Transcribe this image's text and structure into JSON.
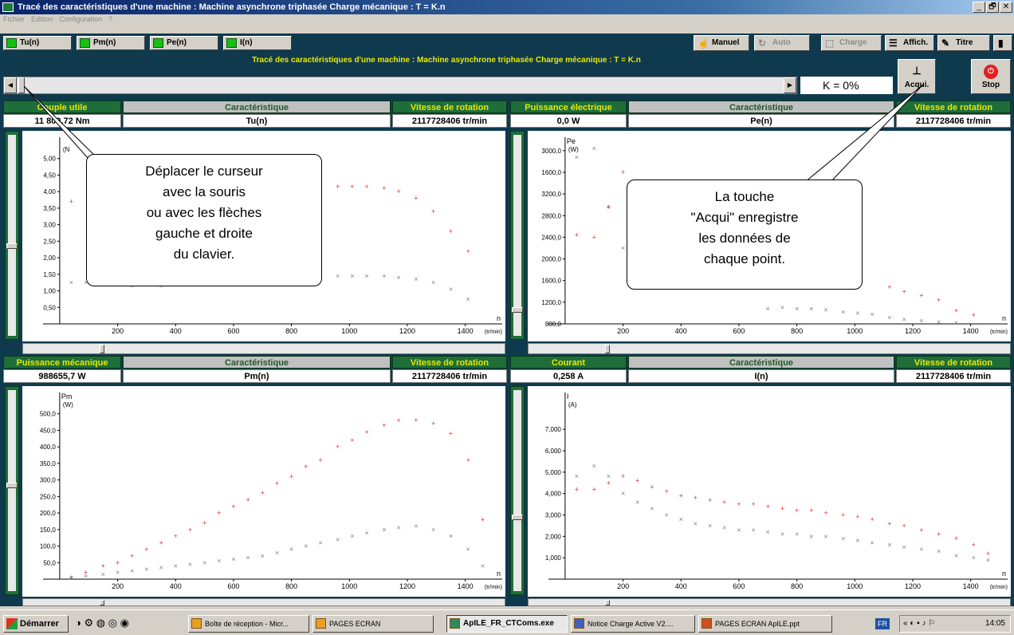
{
  "window": {
    "title": "Tracé des caractéristiques d'une machine : Machine asynchrone triphasée Charge mécanique : T = K.n",
    "controls": [
      "_",
      "🗗",
      "✕"
    ]
  },
  "menu": [
    "Fichier",
    "Edition",
    "Configuration",
    "?"
  ],
  "toolbar": {
    "curves": [
      "Tu(n)",
      "Pm(n)",
      "Pe(n)",
      "I(n)"
    ],
    "manuel": "Manuel",
    "auto": "Auto",
    "charge": "Charge",
    "affich": "Affich.",
    "titre": "Titre"
  },
  "banner": "Tracé des caractéristiques d'une machine : Machine asynchrone triphasée Charge mécanique : T = K.n",
  "k_value": "K = 0%",
  "acqui_label": "Acqui.",
  "stop_label": "Stop",
  "panels": [
    {
      "name": "Couple utile",
      "col": "Caractéristique",
      "speed_label": "Vitesse de rotation",
      "value": "11 800,72 Nm",
      "func": "Tu(n)",
      "speed": "2117728406 tr/min",
      "unit": "(N",
      "ylabel": ""
    },
    {
      "name": "Puissance électrique",
      "col": "Caractéristique",
      "speed_label": "Vitesse de rotation",
      "value": "0,0 W",
      "func": "Pe(n)",
      "speed": "2117728406 tr/min",
      "unit": "(W)",
      "ylabel": "Pe"
    },
    {
      "name": "Puissance mécanique",
      "col": "Caractéristique",
      "speed_label": "Vitesse de rotation",
      "value": "988655,7 W",
      "func": "Pm(n)",
      "speed": "2117728406 tr/min",
      "unit": "(W)",
      "ylabel": "Pm"
    },
    {
      "name": "Courant",
      "col": "Caractéristique",
      "speed_label": "Vitesse de rotation",
      "value": "0,258 A",
      "func": "I(n)",
      "speed": "2117728406 tr/min",
      "unit": "(A)",
      "ylabel": "I"
    }
  ],
  "chart_data": [
    {
      "type": "scatter",
      "xlabel": "n",
      "xunit": "(tr/min)",
      "xticks": [
        200,
        400,
        600,
        800,
        1000,
        1200,
        1400
      ],
      "ylim": [
        0,
        5.5
      ],
      "yticks": [
        "5,00",
        "4,50",
        "4,00",
        "3,50",
        "3,00",
        "2,50",
        "2,00",
        "1,50",
        "1,00",
        "0,50"
      ],
      "ytick_values": [
        5,
        4.5,
        4,
        3.5,
        3,
        2.5,
        2,
        1.5,
        1,
        0.5
      ],
      "series": [
        {
          "marker": "+",
          "color": "#e03030",
          "x": [
            40,
            100,
            960,
            1010,
            1060,
            1120,
            1170,
            1230,
            1290,
            1350,
            1410
          ],
          "values": [
            3.7,
            3.6,
            4.15,
            4.15,
            4.15,
            4.1,
            4.0,
            3.8,
            3.4,
            2.8,
            2.2
          ]
        },
        {
          "marker": "x",
          "color": "#808080",
          "x": [
            40,
            90,
            150,
            200,
            250,
            300,
            350,
            400,
            450,
            500,
            550,
            600,
            650,
            700,
            750,
            800,
            850,
            900,
            960,
            1010,
            1060,
            1120,
            1170,
            1230,
            1290,
            1350,
            1410
          ],
          "values": [
            1.25,
            1.25,
            1.2,
            1.2,
            1.15,
            1.2,
            1.15,
            1.2,
            1.2,
            1.25,
            1.2,
            1.25,
            1.3,
            1.3,
            1.35,
            1.35,
            1.4,
            1.4,
            1.45,
            1.45,
            1.45,
            1.45,
            1.4,
            1.35,
            1.25,
            1.05,
            0.75
          ]
        }
      ]
    },
    {
      "type": "scatter",
      "xlabel": "n",
      "xunit": "(tr/min)",
      "xticks": [
        200,
        400,
        600,
        800,
        1000,
        1200,
        1400
      ],
      "ylim": [
        0,
        8.4
      ],
      "yticks": [
        "3000,0",
        "1600,0",
        "3200,0",
        "2800,0",
        "2400,0",
        "2000,0",
        "1600,0",
        "1200,0",
        "800,0",
        "400,0"
      ],
      "ytick_values": [
        8,
        7,
        6,
        5,
        4,
        3,
        2,
        1,
        0,
        -1
      ],
      "series": [
        {
          "marker": "+",
          "color": "#e03030",
          "x": [
            40,
            100,
            150,
            200,
            1120,
            1170,
            1230,
            1290,
            1350,
            1410
          ],
          "values": [
            4.1,
            4.0,
            5.4,
            7.0,
            1.7,
            1.5,
            1.3,
            1.1,
            0.6,
            0.4
          ]
        },
        {
          "marker": "x",
          "color": "#808080",
          "x": [
            40,
            100,
            150,
            200,
            700,
            750,
            800,
            850,
            900,
            960,
            1010,
            1060,
            1120,
            1170,
            1230,
            1290,
            1350,
            1410
          ],
          "values": [
            7.7,
            8.1,
            5.4,
            3.5,
            0.7,
            0.75,
            0.7,
            0.7,
            0.65,
            0.55,
            0.5,
            0.45,
            0.3,
            0.2,
            0.15,
            0.1,
            0.05,
            -0.1
          ]
        }
      ]
    },
    {
      "type": "scatter",
      "xlabel": "n",
      "xunit": "(tr/min)",
      "xticks": [
        200,
        400,
        600,
        800,
        1000,
        1200,
        1400
      ],
      "ylim": [
        0,
        550
      ],
      "yticks": [
        "500,0",
        "450,0",
        "400,0",
        "350,0",
        "300,0",
        "250,0",
        "200,0",
        "150,0",
        "100,0",
        "50,0"
      ],
      "ytick_values": [
        500,
        450,
        400,
        350,
        300,
        250,
        200,
        150,
        100,
        50
      ],
      "series": [
        {
          "marker": "+",
          "color": "#e03030",
          "x": [
            40,
            90,
            150,
            200,
            250,
            300,
            350,
            400,
            450,
            500,
            550,
            600,
            650,
            700,
            750,
            800,
            850,
            900,
            960,
            1010,
            1060,
            1120,
            1170,
            1230,
            1290,
            1350,
            1410,
            1460
          ],
          "values": [
            5,
            20,
            40,
            50,
            70,
            90,
            110,
            130,
            150,
            170,
            200,
            220,
            240,
            260,
            290,
            310,
            340,
            360,
            400,
            420,
            445,
            465,
            480,
            480,
            470,
            440,
            360,
            180
          ]
        },
        {
          "marker": "x",
          "color": "#808080",
          "x": [
            40,
            90,
            150,
            200,
            250,
            300,
            350,
            400,
            450,
            500,
            550,
            600,
            650,
            700,
            750,
            800,
            850,
            900,
            960,
            1010,
            1060,
            1120,
            1170,
            1230,
            1290,
            1350,
            1410,
            1460
          ],
          "values": [
            5,
            10,
            15,
            20,
            25,
            30,
            35,
            40,
            45,
            50,
            55,
            60,
            65,
            70,
            80,
            90,
            100,
            110,
            120,
            130,
            140,
            150,
            155,
            160,
            150,
            130,
            90,
            40
          ]
        }
      ]
    },
    {
      "type": "scatter",
      "xlabel": "n",
      "xunit": "(tr/min)",
      "xticks": [
        200,
        400,
        600,
        800,
        1000,
        1200,
        1400
      ],
      "ylim": [
        0,
        8.5
      ],
      "yticks": [
        "7,000",
        "6,000",
        "5,000",
        "4,000",
        "3,000",
        "2,000",
        "1,000"
      ],
      "ytick_values": [
        7,
        6,
        5,
        4,
        3,
        2,
        1
      ],
      "series": [
        {
          "marker": "+",
          "color": "#e03030",
          "x": [
            40,
            100,
            150,
            200,
            250,
            300,
            350,
            400,
            450,
            500,
            550,
            600,
            650,
            700,
            750,
            800,
            850,
            900,
            960,
            1010,
            1060,
            1120,
            1170,
            1230,
            1290,
            1350,
            1410,
            1460
          ],
          "values": [
            4.2,
            4.2,
            4.5,
            4.8,
            4.6,
            4.3,
            4.1,
            3.9,
            3.8,
            3.7,
            3.6,
            3.5,
            3.5,
            3.4,
            3.3,
            3.2,
            3.2,
            3.1,
            3.0,
            2.9,
            2.8,
            2.6,
            2.5,
            2.3,
            2.1,
            1.9,
            1.6,
            1.2
          ]
        },
        {
          "marker": "x",
          "color": "#808080",
          "x": [
            40,
            100,
            150,
            200,
            250,
            300,
            350,
            400,
            450,
            500,
            550,
            600,
            650,
            700,
            750,
            800,
            850,
            900,
            960,
            1010,
            1060,
            1120,
            1170,
            1230,
            1290,
            1350,
            1410,
            1460
          ],
          "values": [
            4.8,
            5.3,
            4.8,
            4.0,
            3.6,
            3.3,
            3.0,
            2.8,
            2.6,
            2.5,
            2.4,
            2.3,
            2.3,
            2.2,
            2.1,
            2.1,
            2.0,
            2.0,
            1.9,
            1.8,
            1.7,
            1.6,
            1.5,
            1.4,
            1.3,
            1.1,
            1.0,
            0.9
          ]
        }
      ]
    }
  ],
  "callouts": {
    "left": [
      "Déplacer le curseur",
      "avec la souris",
      "ou avec les flèches",
      "gauche et droite",
      "du clavier."
    ],
    "right": [
      "La touche",
      "\"Acqui\" enregistre",
      "les données de",
      "chaque point."
    ]
  },
  "taskbar": {
    "start": "Démarrer",
    "tasks": [
      "Boîte de réception - Micr...",
      "PAGES ECRAN",
      "ApILE_FR_CTComs.exe",
      "Notice Charge Active V2....",
      "PAGES ECRAN ApILE.ppt"
    ],
    "lang": "FR",
    "time": "14:05"
  }
}
